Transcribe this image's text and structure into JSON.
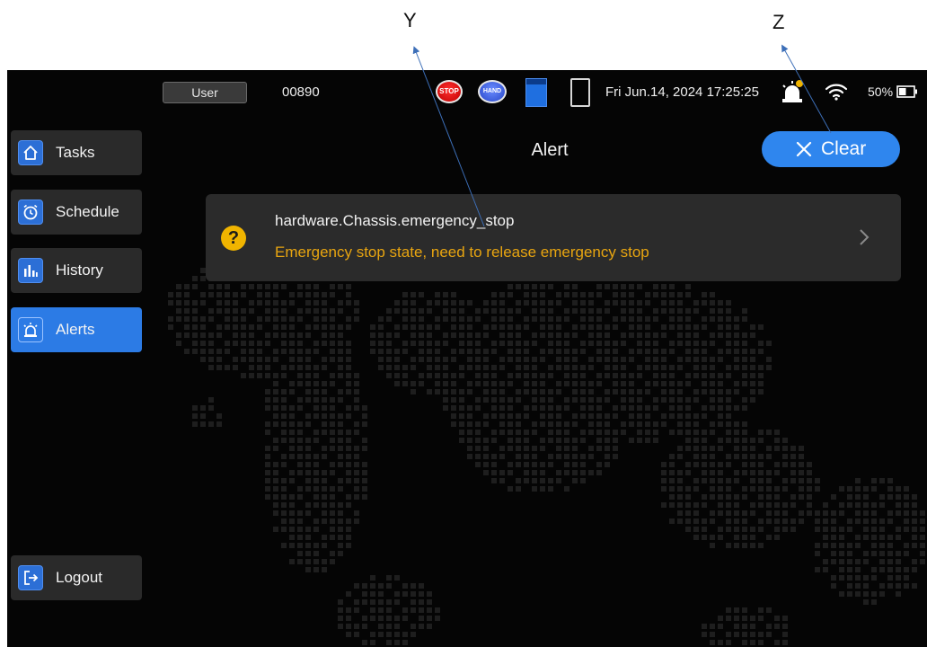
{
  "callouts": {
    "y_label": "Y",
    "z_label": "Z"
  },
  "statusbar": {
    "user_label": "User",
    "robot_id": "00890",
    "stop_label": "STOP",
    "hand_label": "HAND",
    "datetime": "Fri Jun.14, 2024 17:25:25",
    "battery_percent": "50%",
    "battery_level": 0.5,
    "icons": [
      "stop-button-icon",
      "hand-button-icon",
      "blue-status-icon",
      "tablet-icon",
      "alarm-bell-icon",
      "wifi-icon",
      "battery-icon"
    ]
  },
  "sidebar": {
    "items": [
      {
        "label": "Tasks",
        "icon": "home-icon",
        "active": false
      },
      {
        "label": "Schedule",
        "icon": "alarm-clock-icon",
        "active": false
      },
      {
        "label": "History",
        "icon": "bar-chart-icon",
        "active": false
      },
      {
        "label": "Alerts",
        "icon": "alert-siren-icon",
        "active": true
      }
    ],
    "logout": {
      "label": "Logout",
      "icon": "logout-icon"
    }
  },
  "main": {
    "title": "Alert",
    "clear_button": "Clear",
    "alerts": [
      {
        "code": "hardware.Chassis.emergency_stop",
        "message": "Emergency stop state, need to release emergency stop",
        "icon": "question-icon"
      }
    ]
  },
  "colors": {
    "accent": "#2f86ee",
    "warning_text": "#e8a510",
    "warning_icon": "#f0b400",
    "card_bg": "#2b2b2b",
    "screen_bg": "#050505"
  }
}
